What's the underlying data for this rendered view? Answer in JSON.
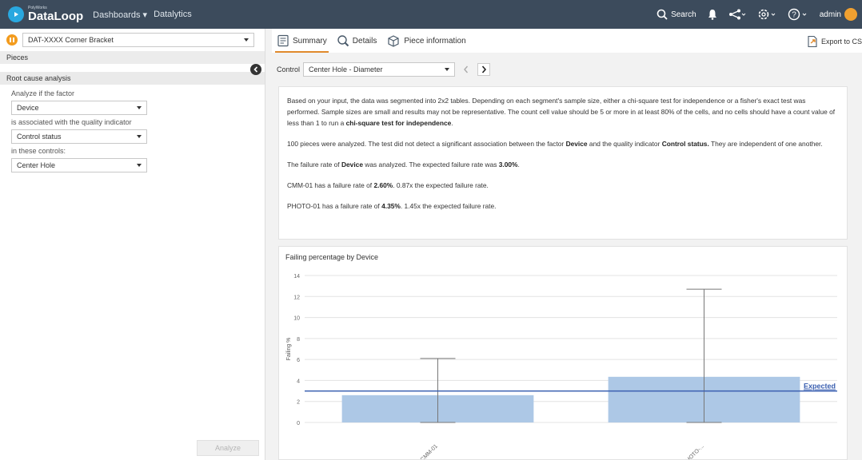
{
  "app": {
    "brand_small": "PolyWorks",
    "brand_name": "DataLoop",
    "nav": [
      "Dashboards ▾",
      "Datalytics"
    ],
    "search_label": "Search",
    "user": "admin"
  },
  "left": {
    "part_name": "DAT-XXXX Corner Bracket",
    "pieces_label": "Pieces",
    "section_title": "Root cause analysis",
    "label_factor": "Analyze if the factor",
    "factor_value": "Device",
    "label_indicator": "is associated with the quality indicator",
    "indicator_value": "Control status",
    "label_controls": "in these controls:",
    "controls_value": "Center Hole",
    "analyze_label": "Analyze"
  },
  "tabs": {
    "summary": "Summary",
    "details": "Details",
    "piece_info": "Piece information",
    "export": "Export to CS"
  },
  "control": {
    "label": "Control",
    "value": "Center Hole - Diameter"
  },
  "summary": {
    "p1_a": "Based on your input, the data was segmented into 2x2 tables. Depending on each segment's sample size, either a chi-square test for independence or a fisher's exact test was performed. Sample sizes are small and results may not be representative. The count cell value should be 5 or more in at least 80% of the cells, and no cells should have a count value of less than 1 to run a ",
    "p1_b": "chi-square test for independence",
    "p1_c": ".",
    "p2_a": "100 pieces were analyzed. The test did not detect a significant association between the factor ",
    "p2_b": "Device",
    "p2_c": " and the quality indicator ",
    "p2_d": "Control status.",
    "p2_e": " They are independent of one another.",
    "p3_a": "The failure rate of ",
    "p3_b": "Device",
    "p3_c": " was analyzed. The expected failure rate was ",
    "p3_d": "3.00%",
    "p3_e": ".",
    "p4_a": "CMM-01 has a failure rate of ",
    "p4_b": "2.60%",
    "p4_c": ". 0.87x the expected failure rate.",
    "p5_a": "PHOTO-01 has a failure rate of ",
    "p5_b": "4.35%",
    "p5_c": ". 1.45x the expected failure rate."
  },
  "chart_data": {
    "type": "bar",
    "title": "Failing percentage by Device",
    "categories": [
      "CMM-01",
      "PHOTO-..."
    ],
    "values": [
      2.6,
      4.35
    ],
    "error_bars": [
      [
        0,
        6.1
      ],
      [
        0,
        12.7
      ]
    ],
    "expected_line": {
      "value": 3.0,
      "label": "Expected"
    },
    "xlabel": "",
    "ylabel": "Failing %",
    "ylim": [
      0,
      14
    ],
    "yticks": [
      0,
      2,
      4,
      6,
      8,
      10,
      12,
      14
    ],
    "grid": true,
    "bar_color": "#adc8e6",
    "line_color": "#3a5fb0"
  },
  "colors": {
    "topbar": "#3c4b5c",
    "accent_tab": "#e08a2c"
  }
}
